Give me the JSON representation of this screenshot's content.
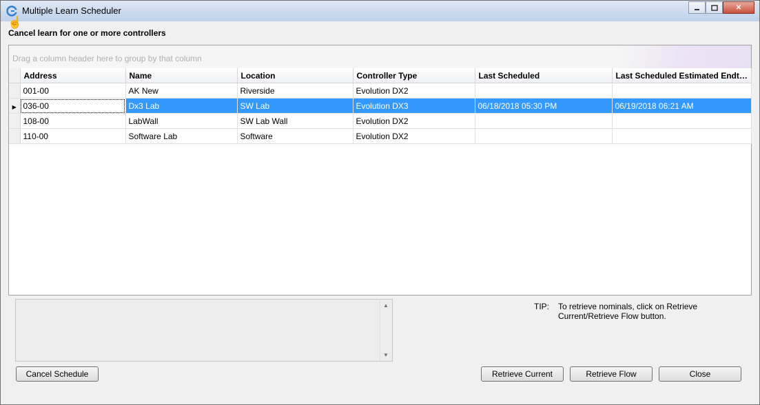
{
  "window": {
    "title": "Multiple Learn Scheduler"
  },
  "heading": "Cancel learn for one or more controllers",
  "grid": {
    "group_hint": "Drag a column header here to group by that column",
    "columns": [
      "Address",
      "Name",
      "Location",
      "Controller Type",
      "Last Scheduled",
      "Last Scheduled Estimated Endt…"
    ],
    "rows": [
      {
        "address": "001-00",
        "name": "AK New",
        "location": "Riverside",
        "type": "Evolution DX2",
        "last_scheduled": "",
        "est_end": ""
      },
      {
        "address": "036-00",
        "name": "Dx3 Lab",
        "location": "SW Lab",
        "type": "Evolution DX3",
        "last_scheduled": "06/18/2018 05:30 PM",
        "est_end": "06/19/2018 06:21 AM"
      },
      {
        "address": "108-00",
        "name": "LabWall",
        "location": "SW Lab Wall",
        "type": "Evolution DX2",
        "last_scheduled": "",
        "est_end": ""
      },
      {
        "address": "110-00",
        "name": "Software Lab",
        "location": "Software",
        "type": "Evolution DX2",
        "last_scheduled": "",
        "est_end": ""
      }
    ],
    "selected_index": 1,
    "selection_color": "#3399ff"
  },
  "tip": {
    "label": "TIP:",
    "text": "To retrieve nominals, click on Retrieve Current/Retrieve Flow button."
  },
  "buttons": {
    "cancel_schedule": "Cancel Schedule",
    "retrieve_current": "Retrieve Current",
    "retrieve_flow": "Retrieve Flow",
    "close": "Close"
  }
}
